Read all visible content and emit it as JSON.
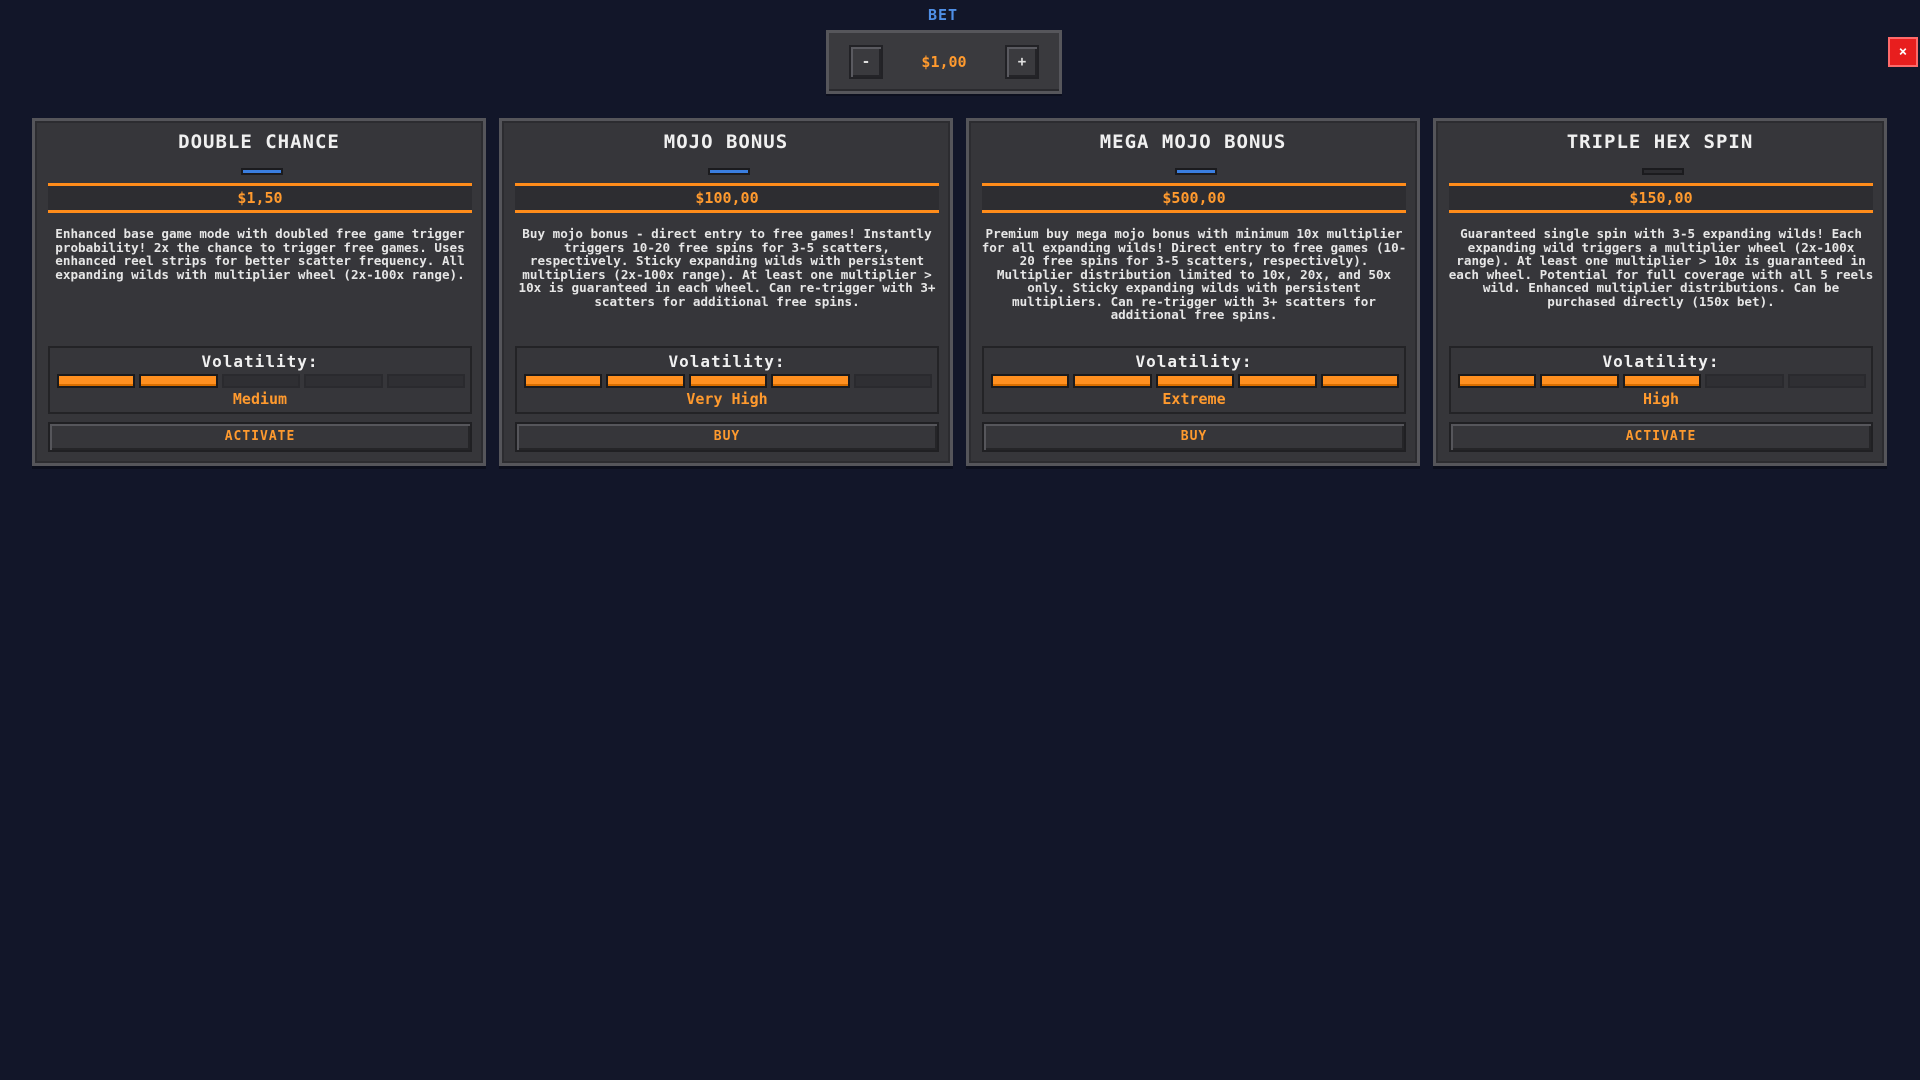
{
  "bet": {
    "label": "BET",
    "minus_label": "-",
    "plus_label": "+",
    "value": "$1,00"
  },
  "close_label": "×",
  "colors": {
    "background": "#121629",
    "accent": "#ff9a2e",
    "bet_label": "#4f8fe6",
    "indicator_active": "#3a7ee0",
    "close": "#e81e1e"
  },
  "cards": [
    {
      "title": "DOUBLE CHANCE",
      "indicator_active": true,
      "price": "$1,50",
      "description": "Enhanced base game mode with doubled free game trigger probability! 2x the chance to trigger free games. Uses enhanced reel strips for better scatter frequency. All expanding wilds with multiplier wheel (2x-100x range).",
      "volatility_label": "Volatility:",
      "volatility_level": 2,
      "volatility_max": 5,
      "volatility_text": "Medium",
      "action_label": "ACTIVATE"
    },
    {
      "title": "MOJO BONUS",
      "indicator_active": true,
      "price": "$100,00",
      "description": "Buy mojo bonus - direct entry to free games! Instantly triggers 10-20 free spins for 3-5 scatters, respectively. Sticky expanding wilds with persistent multipliers (2x-100x range). At least one multiplier > 10x is guaranteed in each wheel. Can re-trigger with 3+ scatters for additional free spins.",
      "volatility_label": "Volatility:",
      "volatility_level": 4,
      "volatility_max": 5,
      "volatility_text": "Very High",
      "action_label": "BUY"
    },
    {
      "title": "MEGA MOJO BONUS",
      "indicator_active": true,
      "price": "$500,00",
      "description": "Premium buy mega mojo bonus with minimum 10x multiplier for all expanding wilds! Direct entry to free games (10-20 free spins for 3-5 scatters, respectively). Multiplier distribution limited to 10x, 20x, and 50x only. Sticky expanding wilds with persistent multipliers. Can re-trigger with 3+ scatters for additional free spins.",
      "volatility_label": "Volatility:",
      "volatility_level": 5,
      "volatility_max": 5,
      "volatility_text": "Extreme",
      "action_label": "BUY"
    },
    {
      "title": "TRIPLE HEX SPIN",
      "indicator_active": false,
      "price": "$150,00",
      "description": "Guaranteed single spin with 3-5 expanding wilds! Each expanding wild triggers a multiplier wheel (2x-100x range). At least one multiplier > 10x is guaranteed in each wheel. Potential for full coverage with all 5 reels wild. Enhanced multiplier distributions. Can be purchased directly (150x bet).",
      "volatility_label": "Volatility:",
      "volatility_level": 3,
      "volatility_max": 5,
      "volatility_text": "High",
      "action_label": "ACTIVATE"
    }
  ]
}
